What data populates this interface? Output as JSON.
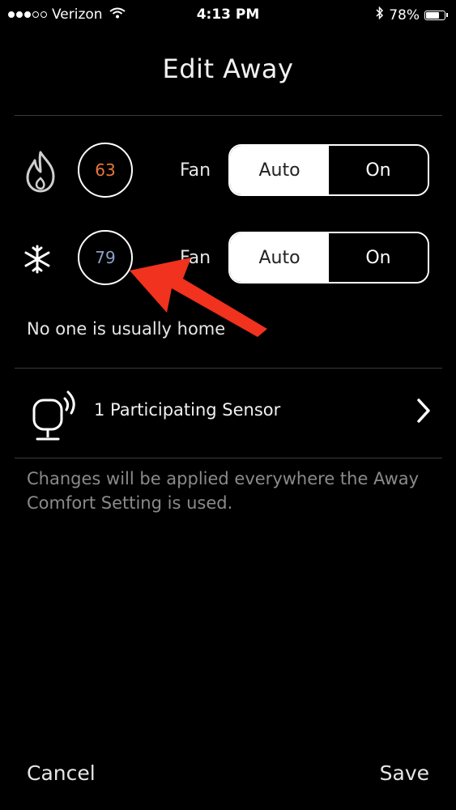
{
  "status_bar": {
    "carrier": "Verizon",
    "time": "4:13 PM",
    "battery": "78%",
    "battery_level": 0.78,
    "signal_filled": 3,
    "signal_total": 5
  },
  "header": {
    "title": "Edit Away"
  },
  "heat": {
    "icon": "flame-icon",
    "setpoint": "63",
    "color": "#e8763a"
  },
  "cool": {
    "icon": "snowflake-icon",
    "setpoint": "79",
    "color": "#8aa0c8"
  },
  "fan": {
    "label": "Fan",
    "options": [
      "Auto",
      "On"
    ],
    "selected": "Auto"
  },
  "occupancy_note": "No one is usually home",
  "sensor": {
    "icon": "sensor-icon",
    "label": "1 Participating Sensor"
  },
  "changes_note": "Changes will be applied everywhere the Away Comfort Setting is used.",
  "footer": {
    "cancel": "Cancel",
    "save": "Save"
  },
  "annotation": {
    "color": "#f0321e"
  }
}
